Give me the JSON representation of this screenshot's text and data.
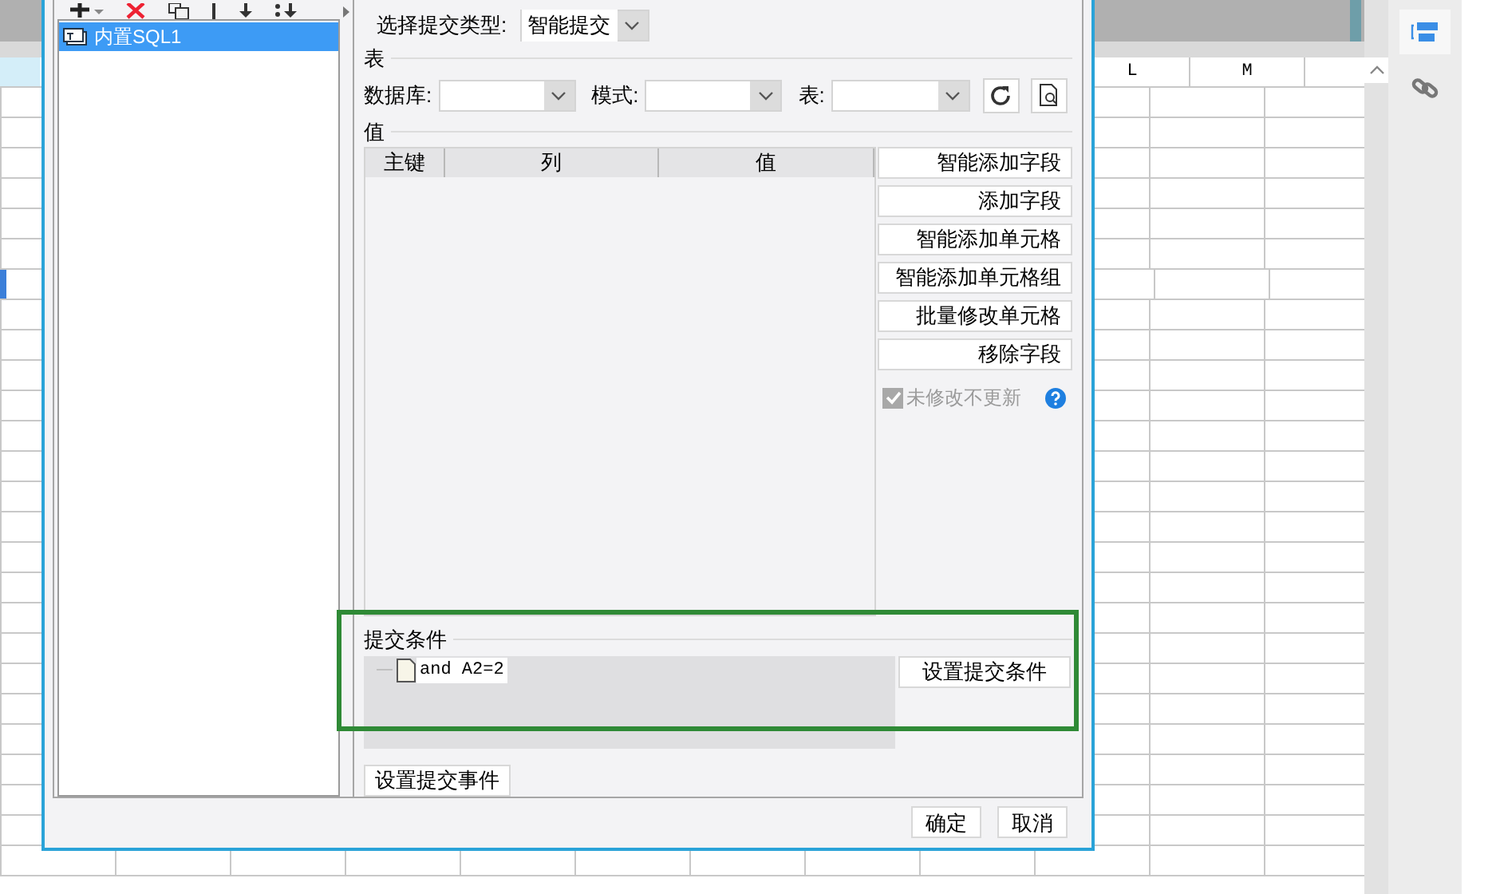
{
  "dialog": {
    "tree": [
      {
        "label": "内置SQL1",
        "selected": true
      }
    ],
    "submit_type": {
      "label": "选择提交类型:",
      "value": "智能提交"
    },
    "table_section": {
      "title": "表",
      "fields": [
        {
          "label": "数据库:"
        },
        {
          "label": "模式:"
        },
        {
          "label": "表:"
        }
      ]
    },
    "value_section": {
      "title": "值",
      "columns": [
        "主键",
        "列",
        "值"
      ]
    },
    "side_buttons": [
      "智能添加字段",
      "添加字段",
      "智能添加单元格",
      "智能添加单元格组",
      "批量修改单元格",
      "移除字段"
    ],
    "unchanged_checkbox": {
      "label": "未修改不更新",
      "checked": true,
      "disabled": true
    },
    "condition_section": {
      "title": "提交条件",
      "conditions": [
        {
          "text": "and A2=2"
        }
      ],
      "button": "设置提交条件"
    },
    "event_button": "设置提交事件",
    "footer_buttons": [
      "确定",
      "取消"
    ]
  },
  "sheet": {
    "columns": [
      "L",
      "M"
    ]
  }
}
